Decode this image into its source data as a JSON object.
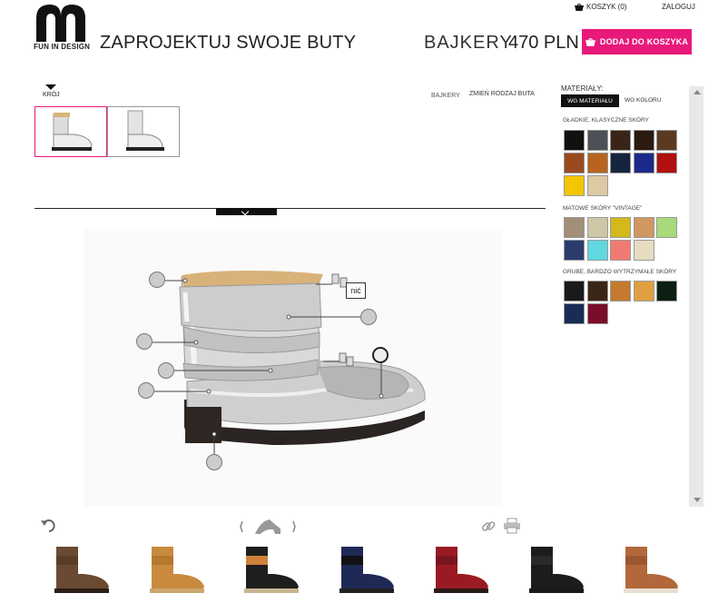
{
  "header": {
    "logo_text": "FUN IN DESIGN",
    "page_title": "ZAPROJEKTUJ SWOJE BUTY",
    "cart_label": "KOSZYK (0)",
    "login_label": "ZALOGUJ",
    "product_name": "BAJKERY",
    "product_price": "470 PLN",
    "add_to_cart_label": "DODAJ DO KOSZYKA"
  },
  "cut": {
    "tab_label": "KRÓJ",
    "breadcrumb_current": "BAJKERY",
    "breadcrumb_change": "ZMIEŃ RODZAJ BUTA"
  },
  "stage": {
    "thread_label": "nić"
  },
  "materials": {
    "title": "MATERIAŁY:",
    "tab_material": "WG MATERIAŁU",
    "tab_color": "WG KOLORU",
    "groups": [
      {
        "title": "GŁADKIE, KLASYCZNE SKÓRY",
        "colors": [
          "#111111",
          "#4d5057",
          "#3a2418",
          "#2a1a10",
          "#5b3a22",
          "#9a4a1e",
          "#b8641f",
          "#15253d",
          "#1b2a8a",
          "#b01010",
          "#f2c600",
          "#ddc9a3"
        ]
      },
      {
        "title": "MATOWE SKÓRY \"VINTAGE\"",
        "colors": [
          "#a38f78",
          "#cfc6a6",
          "#d5b81a",
          "#d09860",
          "#a8d97a",
          "#2b3b6e",
          "#5fd8e0",
          "#f07a72",
          "#e6dcc0"
        ]
      },
      {
        "title": "GRUBE, BARDZO WYTRZYMAŁE SKÓRY",
        "colors": [
          "#1a1a1a",
          "#3b2616",
          "#c47a2e",
          "#e0a040",
          "#0b2012",
          "#182c55",
          "#7a0d2a"
        ]
      }
    ]
  },
  "toolbar": {
    "undo_icon": "undo-icon",
    "shoe_icon": "heel-shoe-icon",
    "link_icon": "link-icon",
    "print_icon": "print-icon"
  },
  "gallery": [
    {
      "name": "brown-boot",
      "upper": "#6a4a32",
      "cuff": "#5a3c28",
      "sole": "#2a1e16"
    },
    {
      "name": "tan-boot",
      "upper": "#c98a3e",
      "cuff": "#b5782f",
      "sole": "#caa670"
    },
    {
      "name": "black-orange-boot",
      "upper": "#1e1e1e",
      "cuff": "#d0803a",
      "sole": "#c7b58f"
    },
    {
      "name": "navy-boot",
      "upper": "#1e2a55",
      "cuff": "#111111",
      "sole": "#222222"
    },
    {
      "name": "red-boot",
      "upper": "#9a1a24",
      "cuff": "#7a1520",
      "sole": "#2a1a14"
    },
    {
      "name": "black-boot",
      "upper": "#1c1c1c",
      "cuff": "#2a2a2a",
      "sole": "#1a1a1a"
    },
    {
      "name": "cognac-boot",
      "upper": "#b2683a",
      "cuff": "#9c5730",
      "sole": "#e8e0d0"
    }
  ]
}
